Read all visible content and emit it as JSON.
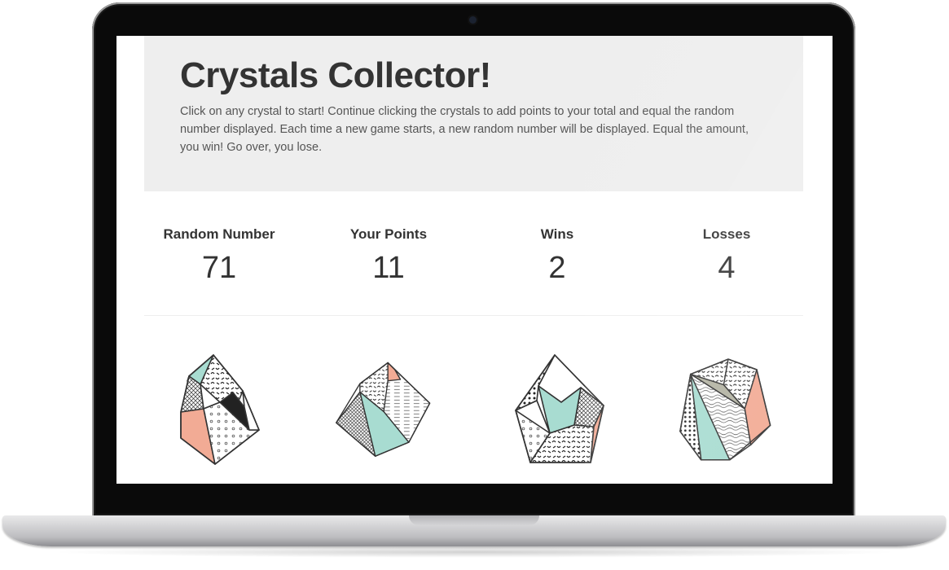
{
  "header": {
    "title": "Crystals Collector!",
    "instructions": "Click on any crystal to start! Continue clicking the crystals to add points to your total and equal the random number displayed. Each time a new game starts, a new random number will be displayed. Equal the amount, you win! Go over, you lose."
  },
  "stats": {
    "random": {
      "label": "Random Number",
      "value": "71"
    },
    "points": {
      "label": "Your Points",
      "value": "11"
    },
    "wins": {
      "label": "Wins",
      "value": "2"
    },
    "losses": {
      "label": "Losses",
      "value": "4"
    }
  },
  "crystals": [
    {
      "icon": "crystal-1-icon"
    },
    {
      "icon": "crystal-2-icon"
    },
    {
      "icon": "crystal-3-icon"
    },
    {
      "icon": "crystal-4-icon"
    }
  ],
  "colors": {
    "mint": "#a8dcd1",
    "salmon": "#f2ab95",
    "sage": "#b3b3a3",
    "jumbotron": "#eeeeee",
    "text": "#333333"
  }
}
